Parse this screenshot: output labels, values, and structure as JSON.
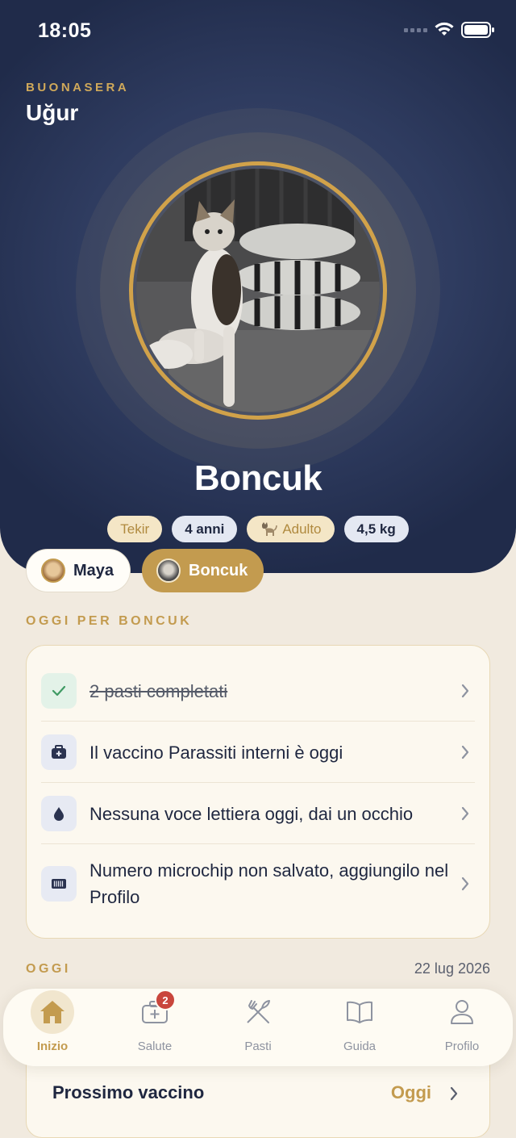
{
  "status_bar": {
    "time": "18:05"
  },
  "header": {
    "greeting": "BUONASERA",
    "user_name": "Uğur"
  },
  "pet": {
    "name": "Boncuk",
    "chips": [
      {
        "label": "Tekir",
        "style": "gold"
      },
      {
        "label": "4 anni",
        "style": "blue"
      },
      {
        "label": "Adulto",
        "style": "gold",
        "icon": "cat-icon"
      },
      {
        "label": "4,5 kg",
        "style": "blue"
      }
    ]
  },
  "pet_switcher": [
    {
      "label": "Maya",
      "active": false
    },
    {
      "label": "Boncuk",
      "active": true
    }
  ],
  "today_section": {
    "title": "OGGI PER BONCUK",
    "tasks": [
      {
        "text": "2 pasti completati",
        "icon": "check-icon",
        "done": true
      },
      {
        "text": "Il vaccino Parassiti interni è oggi",
        "icon": "medical-kit-icon",
        "done": false
      },
      {
        "text": "Nessuna voce lettiera oggi, dai un occhio",
        "icon": "drop-icon",
        "done": false
      },
      {
        "text": "Numero microchip non salvato, aggiungilo nel Profilo",
        "icon": "barcode-icon",
        "done": false
      }
    ]
  },
  "oggi_section": {
    "title": "OGGI",
    "date": "22 lug 2026",
    "next_vaccine_label": "Prossimo vaccino",
    "next_vaccine_value": "Oggi"
  },
  "tabbar": [
    {
      "label": "Inizio",
      "icon": "home-icon",
      "active": true
    },
    {
      "label": "Salute",
      "icon": "medical-kit-icon",
      "badge": "2"
    },
    {
      "label": "Pasti",
      "icon": "fork-knife-icon"
    },
    {
      "label": "Guida",
      "icon": "book-icon"
    },
    {
      "label": "Profilo",
      "icon": "person-icon"
    }
  ],
  "colors": {
    "accent": "#C39B4F",
    "hero": "#2F3C60",
    "background": "#F1EADF",
    "badge": "#C9463C"
  }
}
